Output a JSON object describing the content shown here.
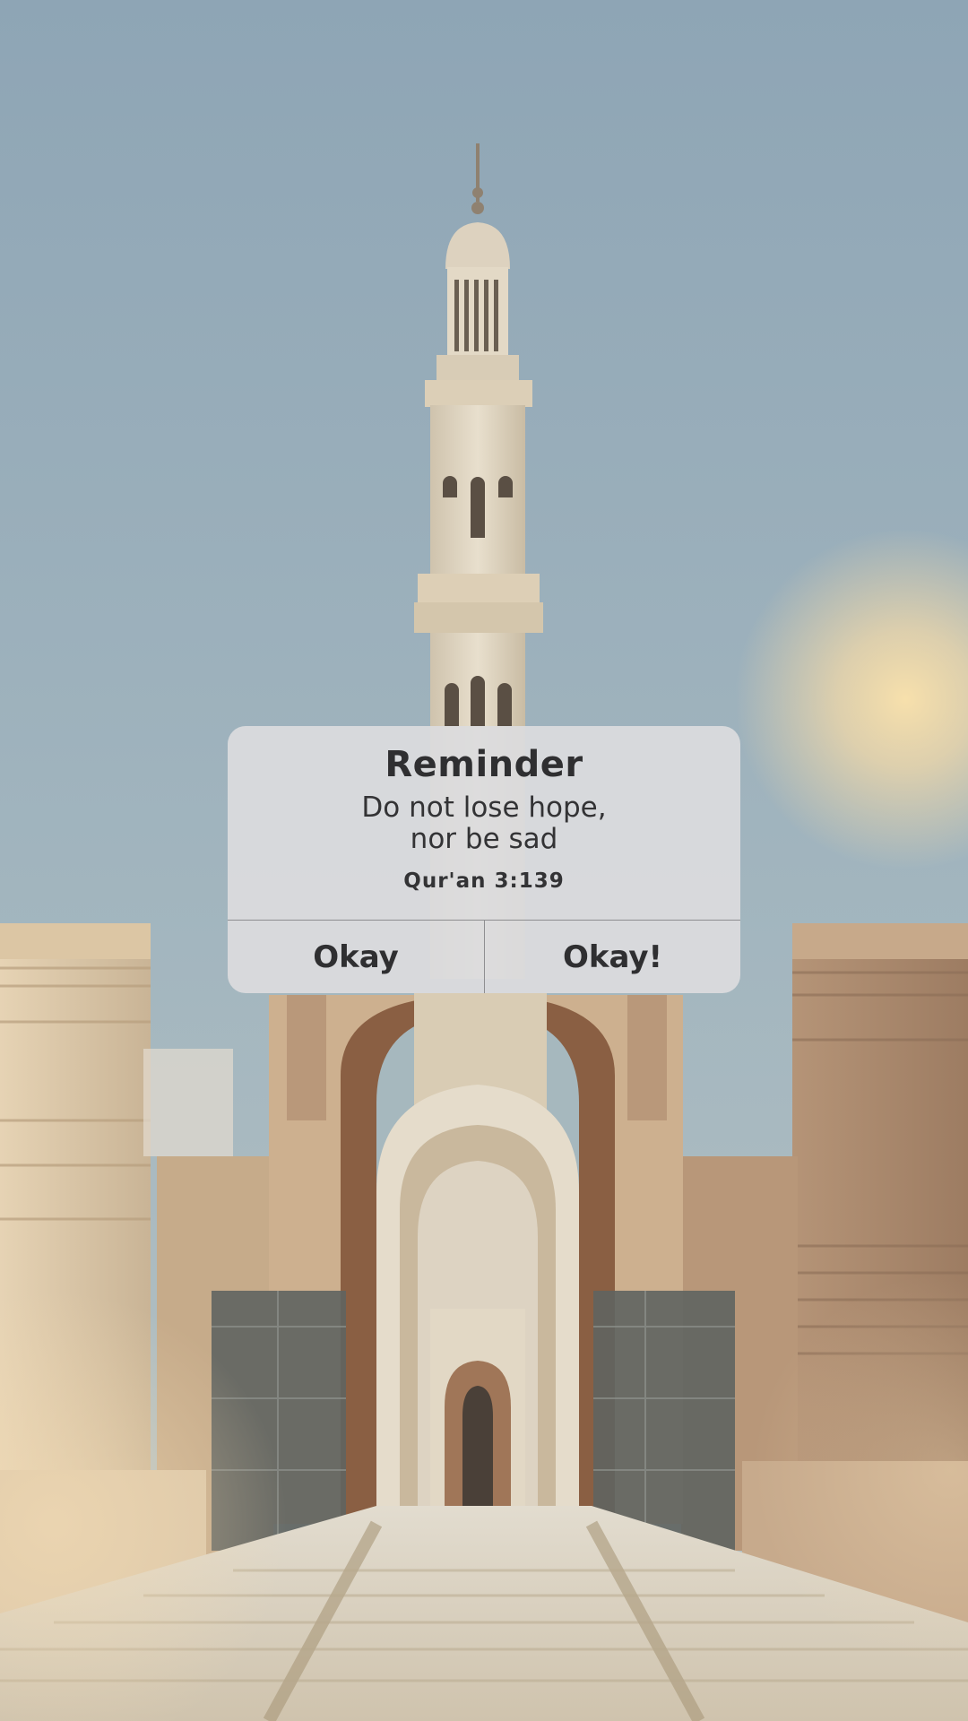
{
  "dialog": {
    "title": "Reminder",
    "message_line1": "Do not lose hope,",
    "message_line2": "nor be sad",
    "source": "Qur'an 3:139",
    "button_left": "Okay",
    "button_right": "Okay!"
  },
  "colors": {
    "sky_top": "#8fa6b6",
    "sky_bottom": "#a9bcc4",
    "stone": "#d9c7ab",
    "dialog_bg": "#dcdcde",
    "text": "#2f2f31"
  }
}
